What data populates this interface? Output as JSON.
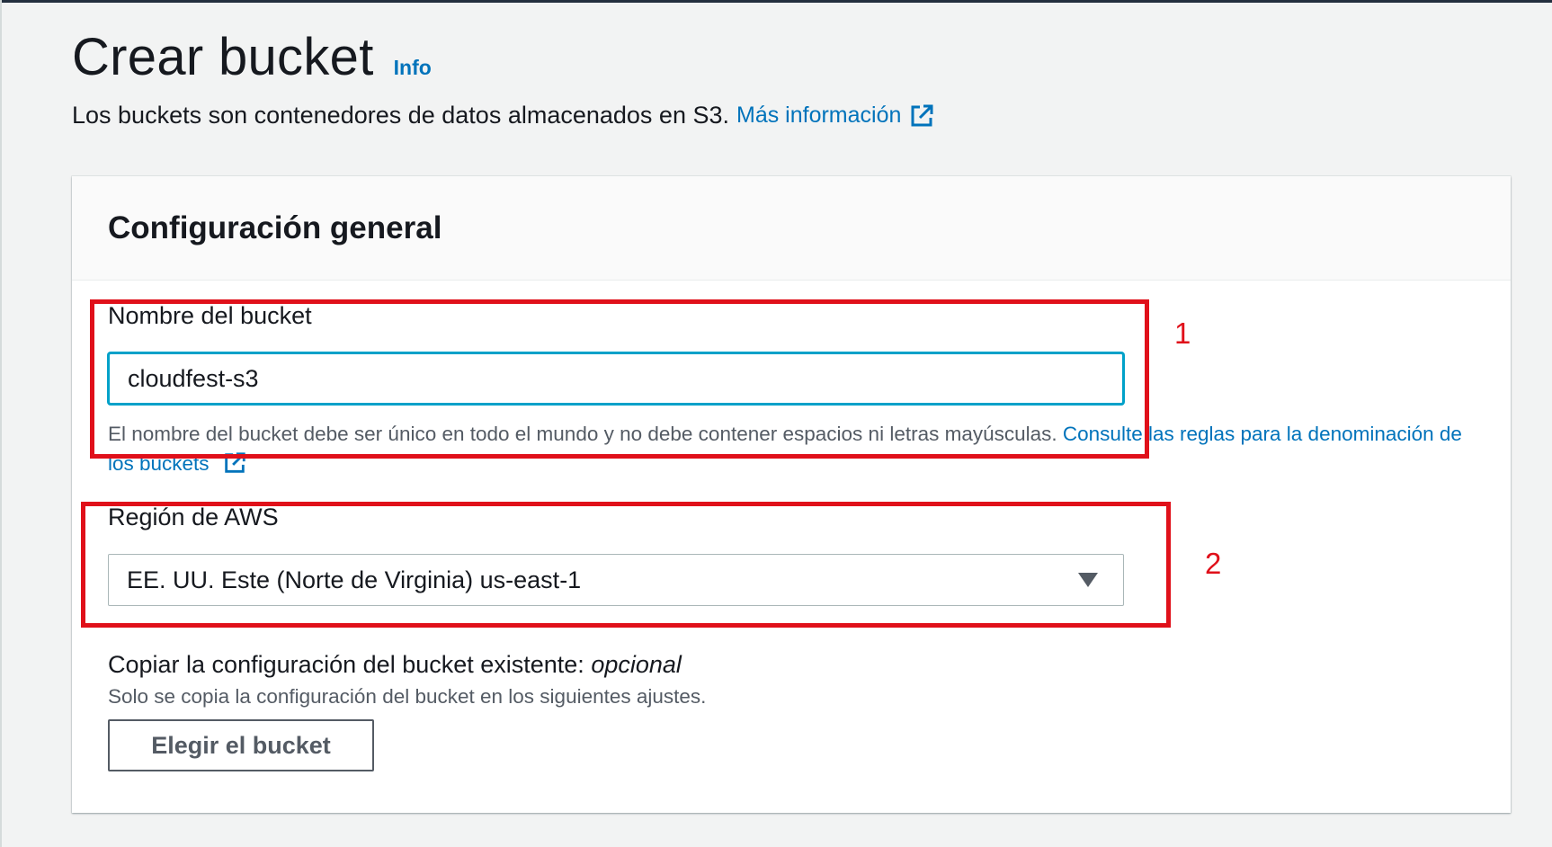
{
  "page": {
    "title": "Crear bucket",
    "info_label": "Info",
    "description": "Los buckets son contenedores de datos almacenados en S3.",
    "more_info_label": "Más información"
  },
  "general_config": {
    "title": "Configuración general",
    "bucket_name": {
      "label": "Nombre del bucket",
      "value": "cloudfest-s3",
      "hint": "El nombre del bucket debe ser único en todo el mundo y no debe contener espacios ni letras mayúsculas.",
      "hint_link": "Consulte las reglas para la denominación de los buckets"
    },
    "region": {
      "label": "Región de AWS",
      "selected": "EE. UU. Este (Norte de Virginia) us-east-1"
    },
    "copy_settings": {
      "label": "Copiar la configuración del bucket existente:",
      "optional": "opcional",
      "description": "Solo se copia la configuración del bucket en los siguientes ajustes.",
      "button_label": "Elegir el bucket"
    }
  },
  "annotations": {
    "marker_1": "1",
    "marker_2": "2",
    "color": "#e0101a"
  },
  "colors": {
    "link": "#0073bb",
    "focus_border": "#00a1c9",
    "text": "#16191f",
    "muted_text": "#545b64"
  },
  "icons": {
    "external_link": "external-link-icon",
    "dropdown": "caret-down-icon"
  }
}
